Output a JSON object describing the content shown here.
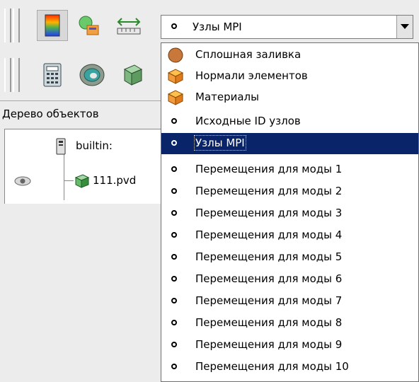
{
  "toolbar": {
    "icons": [
      "color-map-icon",
      "color-legend-icon",
      "ruler-icon",
      "calculator-icon",
      "clip-icon",
      "cube-icon"
    ]
  },
  "combo": {
    "selected": "Узлы MPI"
  },
  "panel": {
    "title": "Дерево объектов",
    "items": [
      "builtin:",
      "111.pvd"
    ]
  },
  "dropdown": {
    "items": [
      {
        "label": "Сплошная заливка",
        "icon": "sphere-icon"
      },
      {
        "label": "Нормали элементов",
        "icon": "cube-icon"
      },
      {
        "label": "Материалы",
        "icon": "cube-icon"
      },
      {
        "label": "Исходные ID узлов",
        "icon": "point-icon"
      },
      {
        "label": "Узлы MPI",
        "icon": "point-icon",
        "selected": true
      },
      {
        "label": "Перемещения для моды 1",
        "icon": "point-icon"
      },
      {
        "label": "Перемещения для моды 2",
        "icon": "point-icon"
      },
      {
        "label": "Перемещения для моды 3",
        "icon": "point-icon"
      },
      {
        "label": "Перемещения для моды 4",
        "icon": "point-icon"
      },
      {
        "label": "Перемещения для моды 5",
        "icon": "point-icon"
      },
      {
        "label": "Перемещения для моды 6",
        "icon": "point-icon"
      },
      {
        "label": "Перемещения для моды 7",
        "icon": "point-icon"
      },
      {
        "label": "Перемещения для моды 8",
        "icon": "point-icon"
      },
      {
        "label": "Перемещения для моды 9",
        "icon": "point-icon"
      },
      {
        "label": "Перемещения для моды 10",
        "icon": "point-icon"
      }
    ]
  },
  "colors": {
    "selection": "#0a246a",
    "sphere": "#c8783a",
    "cube": "#f39a3c",
    "green_cube": "#4caf50"
  }
}
